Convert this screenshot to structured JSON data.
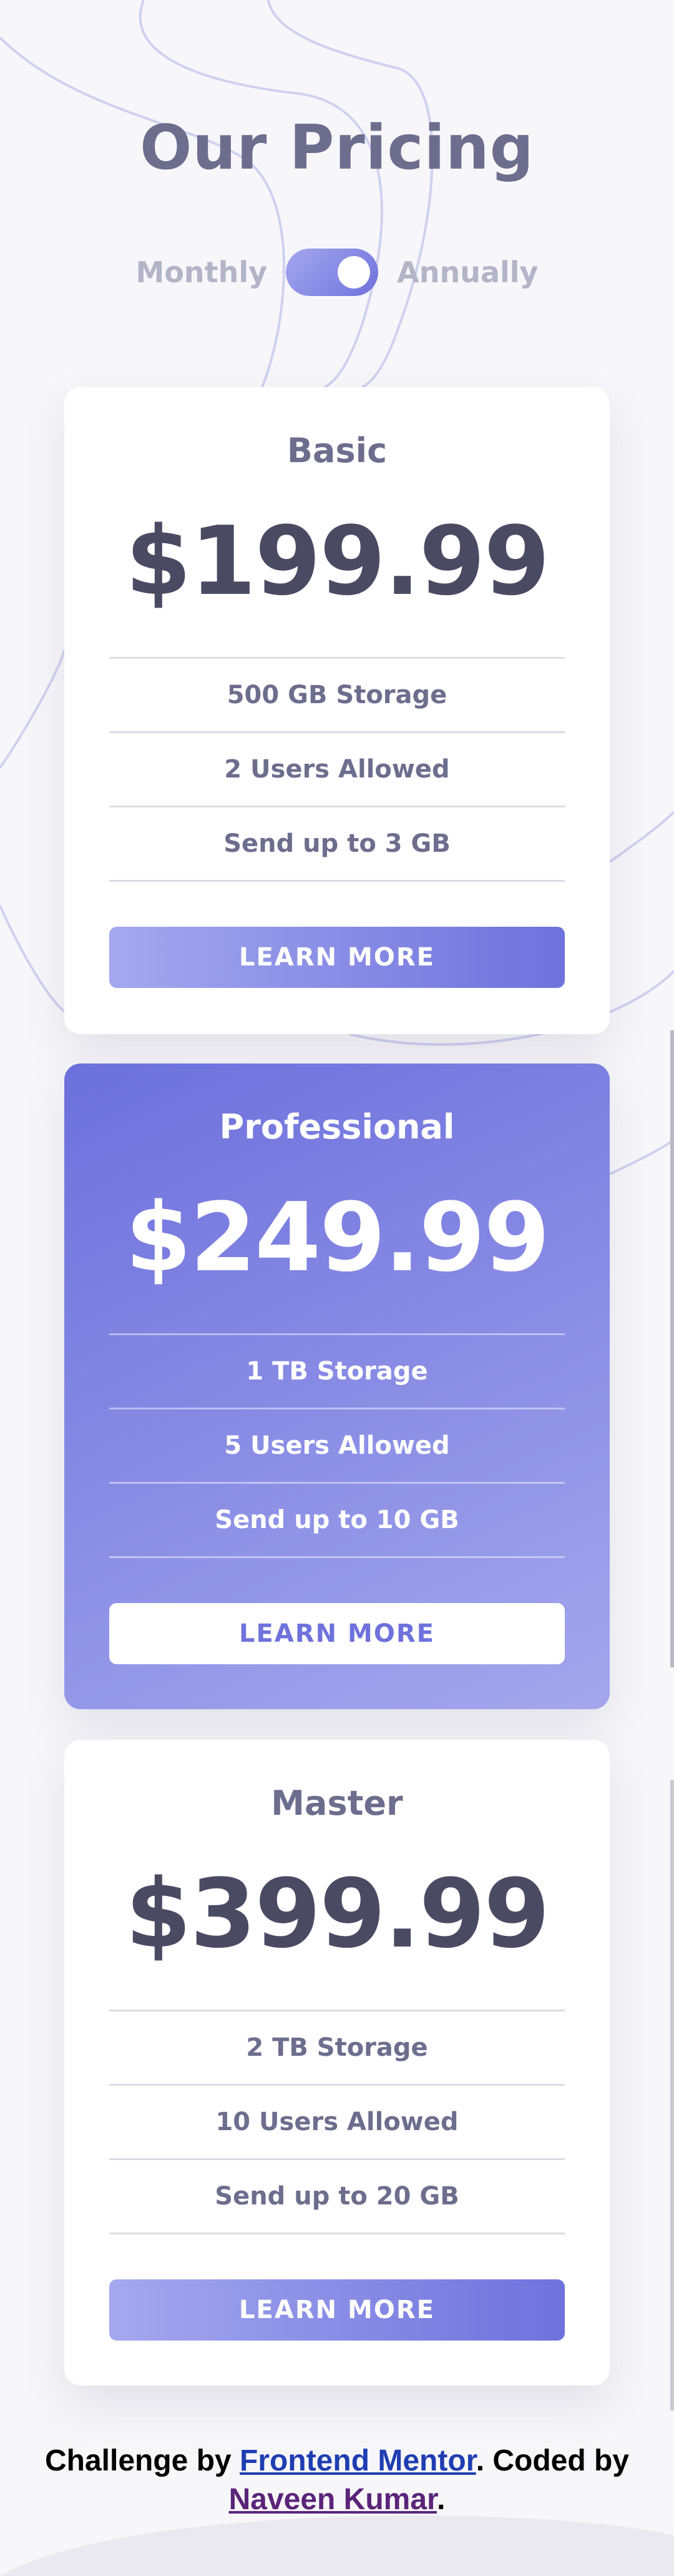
{
  "header": {
    "title": "Our Pricing"
  },
  "billing": {
    "monthly_label": "Monthly",
    "annually_label": "Annually",
    "selected": "Annually"
  },
  "plans": [
    {
      "name": "Basic",
      "price": "$199.99",
      "features": [
        "500 GB Storage",
        "2 Users Allowed",
        "Send up to 3 GB"
      ],
      "cta": "LEARN MORE"
    },
    {
      "name": "Professional",
      "price": "$249.99",
      "features": [
        "1 TB Storage",
        "5 Users Allowed",
        "Send up to 10 GB"
      ],
      "cta": "LEARN MORE"
    },
    {
      "name": "Master",
      "price": "$399.99",
      "features": [
        "2 TB Storage",
        "10 Users Allowed",
        "Send up to 20 GB"
      ],
      "cta": "LEARN MORE"
    }
  ],
  "footer": {
    "prefix": "Challenge by ",
    "mentor_link": "Frontend Mentor",
    "middle": ". Coded by ",
    "author_link": "Naveen Kumar",
    "suffix": "."
  },
  "colors": {
    "accent_start": "#a4a8ee",
    "accent_end": "#6e72dc",
    "heading": "#6d6e8e",
    "price": "#4a4b63",
    "background": "#f7f7fa"
  }
}
